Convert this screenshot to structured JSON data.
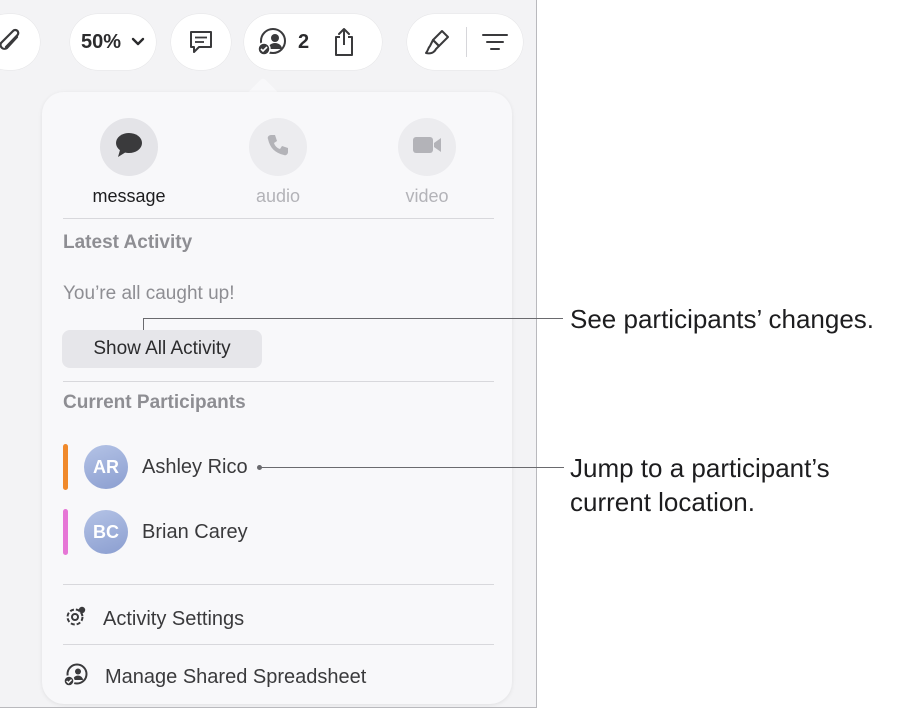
{
  "toolbar": {
    "zoom": "50%",
    "collaborators_count": "2"
  },
  "popover": {
    "comm": {
      "message": "message",
      "audio": "audio",
      "video": "video"
    },
    "latest_activity_title": "Latest Activity",
    "caught_up_text": "You’re all caught up!",
    "show_all_button": "Show All Activity",
    "participants_title": "Current Participants",
    "participants": [
      {
        "initials": "AR",
        "name": "Ashley Rico",
        "bar_color": "#f0892b"
      },
      {
        "initials": "BC",
        "name": "Brian Carey",
        "bar_color": "#e676d6"
      }
    ],
    "activity_settings": "Activity Settings",
    "manage_shared": "Manage Shared Spreadsheet"
  },
  "callouts": {
    "changes": "See participants’ changes.",
    "location_line1": "Jump to a participant’s",
    "location_line2": "current location."
  },
  "icons": [
    "paperclip-icon",
    "chevron-down-icon",
    "comment-icon",
    "collaborate-icon",
    "share-icon",
    "paintbrush-icon",
    "menu-lines-icon",
    "message-icon",
    "phone-icon",
    "video-icon",
    "gear-icon",
    "collaborate-icon"
  ]
}
